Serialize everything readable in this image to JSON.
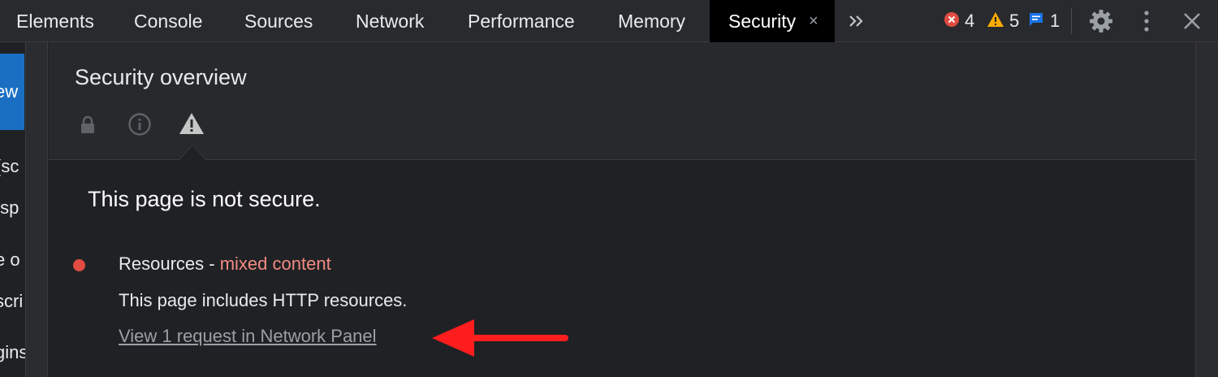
{
  "tabs": [
    {
      "label": "Elements"
    },
    {
      "label": "Console"
    },
    {
      "label": "Sources"
    },
    {
      "label": "Network"
    },
    {
      "label": "Performance"
    },
    {
      "label": "Memory"
    },
    {
      "label": "Security",
      "active": true
    }
  ],
  "tab_close_glyph": "×",
  "counters": {
    "errors": "4",
    "warnings": "5",
    "messages": "1"
  },
  "left_pane": {
    "overview_fragment": "ew",
    "lines": [
      "(sc",
      "/sp",
      "e o",
      "scri",
      "gins"
    ]
  },
  "security": {
    "title": "Security overview",
    "summary": "This page is not secure.",
    "resources_label": "Resources - ",
    "resources_status": "mixed content",
    "resources_description": "This page includes HTTP resources.",
    "network_link": "View 1 request in Network Panel"
  },
  "colors": {
    "accent_active_tab": "#000000",
    "error_red": "#e04b42",
    "warning_yellow": "#f9ab00",
    "message_blue": "#1a73e8",
    "mixed_content": "#f28b82",
    "annotation_arrow": "#ff1e1e"
  },
  "icons": [
    "lock-icon",
    "info-icon",
    "warning-triangle-icon",
    "gear-icon",
    "kebab-icon",
    "close-icon",
    "chevron-double-right-icon"
  ]
}
